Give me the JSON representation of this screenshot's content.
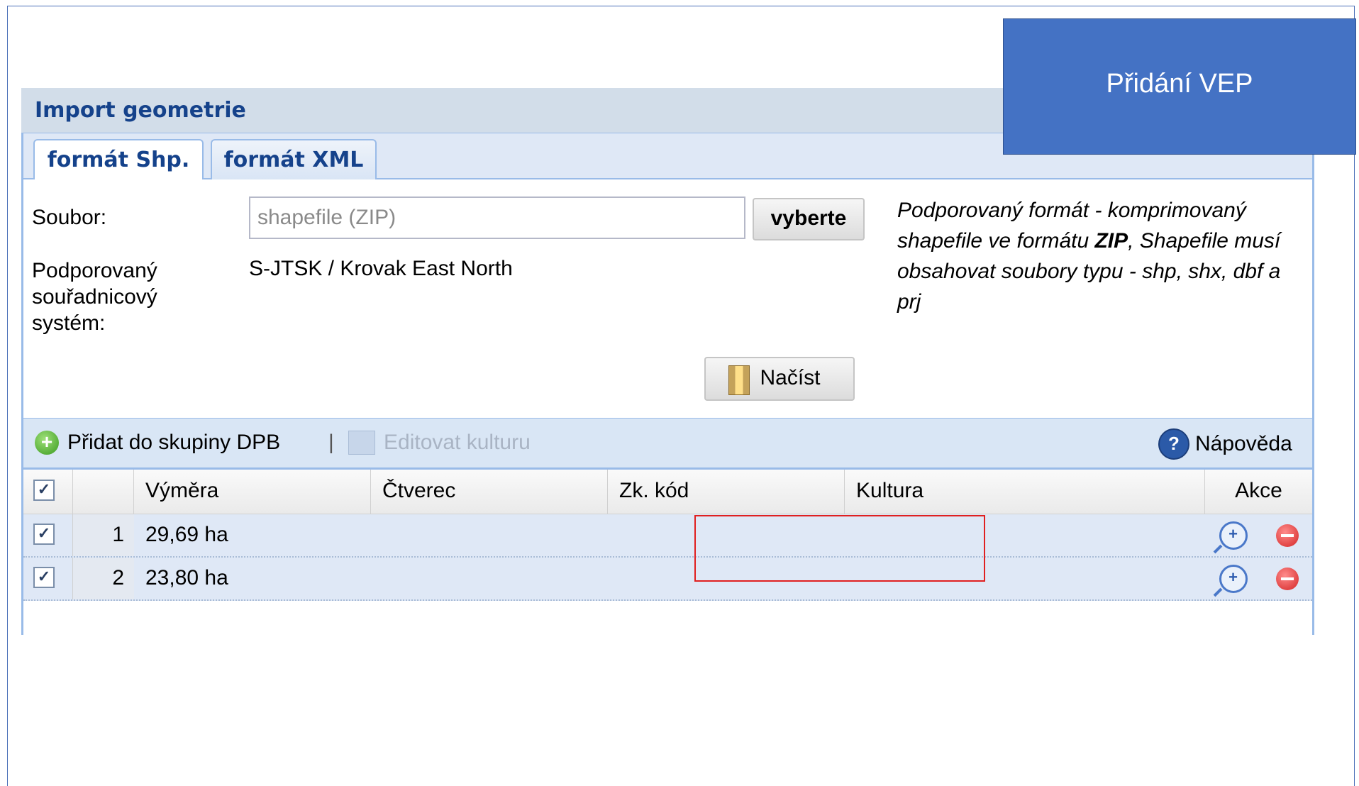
{
  "callout": {
    "title": "Přidání VEP",
    "color": "#4472c4"
  },
  "panel": {
    "title": "Import geometrie",
    "tabs": [
      {
        "label": "formát Shp.",
        "active": true
      },
      {
        "label": "formát XML",
        "active": false
      }
    ]
  },
  "form": {
    "file_label": "Soubor:",
    "file_placeholder": "shapefile (ZIP)",
    "browse_button": "vyberte",
    "crs_label": "Podporovaný souřadnicový systém:",
    "crs_value": "S-JTSK / Krovak East North",
    "help_part1": "Podporovaný formát - komprimovaný shapefile ve formátu ",
    "help_bold": "ZIP",
    "help_part2": ", Shapefile musí obsahovat soubory typu - shp, shx, dbf a prj",
    "load_button": "Načíst",
    "load_icon": "zip-archive-icon"
  },
  "toolbar": {
    "add_label": "Přidat do skupiny DPB",
    "separator": "|",
    "edit_label": "Editovat kulturu",
    "help_label": "Nápověda"
  },
  "grid": {
    "columns": [
      "",
      "",
      "Výměra",
      "Čtverec",
      "Zk. kód",
      "Kultura",
      "Akce"
    ],
    "rows": [
      {
        "checked": true,
        "num": "1",
        "vymera": "29,69 ha",
        "ctverec": "",
        "zk_kod": "",
        "kultura": ""
      },
      {
        "checked": true,
        "num": "2",
        "vymera": "23,80 ha",
        "ctverec": "",
        "zk_kod": "",
        "kultura": ""
      }
    ],
    "highlight_color": "#e02020"
  }
}
